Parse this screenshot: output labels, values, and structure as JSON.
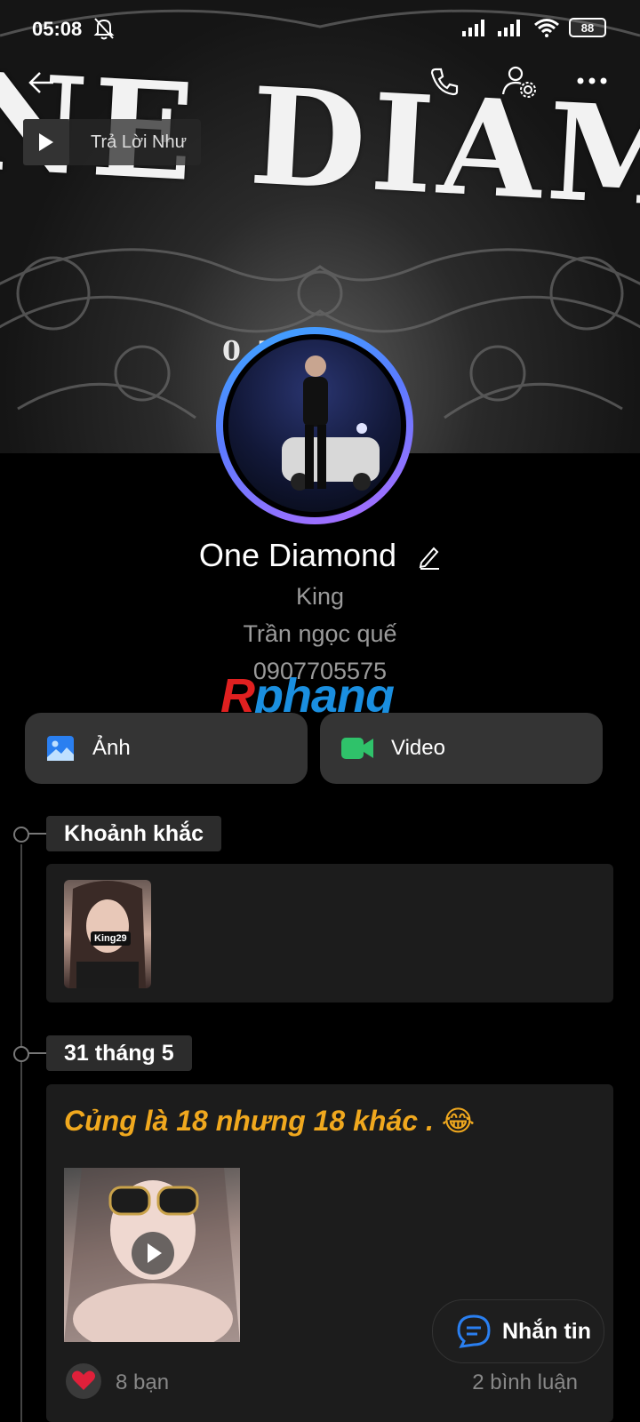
{
  "status_bar": {
    "time": "05:08",
    "battery": "88"
  },
  "cover": {
    "title": "NE DIAMON",
    "number": "0 75"
  },
  "music": {
    "title": "Trả Lời Như"
  },
  "profile": {
    "name": "One Diamond",
    "bio": [
      "King",
      "Trần ngọc quế",
      "0907705575"
    ]
  },
  "watermark": {
    "first": "R",
    "rest": "phang"
  },
  "media_buttons": {
    "photos": "Ảnh",
    "video": "Video"
  },
  "moments": {
    "label": "Khoảnh khắc",
    "thumb_label": "King29"
  },
  "post": {
    "date": "31 tháng 5",
    "text": "Củng là 18 nhưng 18 khác . 😂",
    "likes": "8 bạn",
    "comments": "2 bình luận"
  },
  "fab": {
    "label": "Nhắn tin"
  },
  "colors": {
    "accent_blue": "#1a8fe0",
    "post_text": "#f0a81e",
    "video_green": "#2fc26a"
  }
}
